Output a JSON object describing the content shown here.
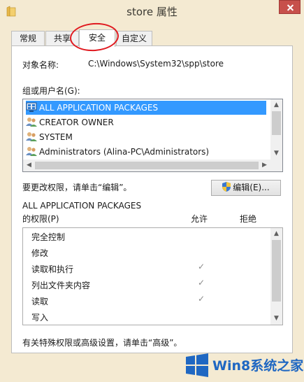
{
  "window": {
    "title": "store 属性"
  },
  "tabs": [
    {
      "label": "常规"
    },
    {
      "label": "共享"
    },
    {
      "label": "安全"
    },
    {
      "label": "自定义"
    }
  ],
  "object": {
    "label": "对象名称:",
    "value": "C:\\Windows\\System32\\spp\\store"
  },
  "groups": {
    "label": "组或用户名(G):",
    "items": [
      {
        "name": "ALL APPLICATION PACKAGES",
        "icon": "app-packages-icon"
      },
      {
        "name": "CREATOR OWNER",
        "icon": "users-icon"
      },
      {
        "name": "SYSTEM",
        "icon": "users-icon"
      },
      {
        "name": "Administrators (Alina-PC\\Administrators)",
        "icon": "users-icon"
      }
    ]
  },
  "change_hint": "要更改权限，请单击“编辑”。",
  "edit_button": "编辑(E)...",
  "permissions": {
    "title": "ALL APPLICATION PACKAGES",
    "subtitle": "的权限(P)",
    "allow_header": "允许",
    "deny_header": "拒绝",
    "rows": [
      {
        "name": "完全控制",
        "allow": ""
      },
      {
        "name": "修改",
        "allow": ""
      },
      {
        "name": "读取和执行",
        "allow": "✓"
      },
      {
        "name": "列出文件夹内容",
        "allow": "✓"
      },
      {
        "name": "读取",
        "allow": "✓"
      },
      {
        "name": "写入",
        "allow": ""
      }
    ]
  },
  "advanced_hint": "有关特殊权限或高级设置，请单击“高级”。",
  "watermark": {
    "text": "Win8系统之家"
  },
  "colors": {
    "selection": "#3399ff",
    "highlight_ring": "#e0191f",
    "watermark": "#1f67c2"
  }
}
